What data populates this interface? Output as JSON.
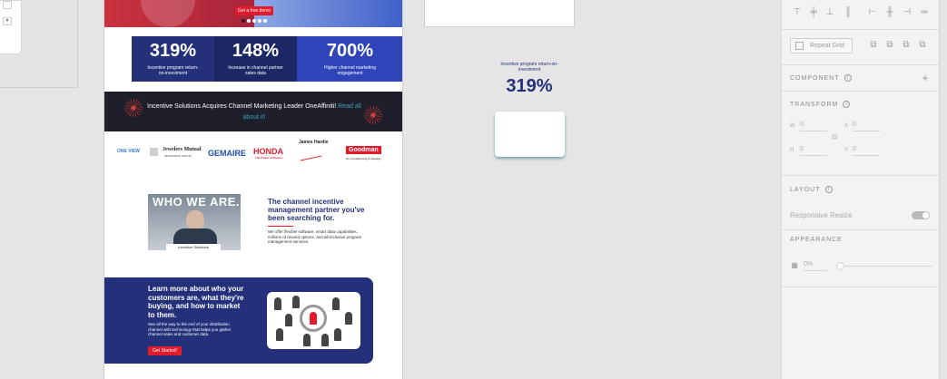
{
  "left_artboard": {
    "mini_arrow": "▾"
  },
  "artboard": {
    "hero": {
      "button_label": "Get a free demo"
    },
    "stats": [
      {
        "value": "319%",
        "label": "Incentive program return-on-investment"
      },
      {
        "value": "148%",
        "label": "Increase in channel partner sales data"
      },
      {
        "value": "700%",
        "label": "Higher channel marketing engagement"
      }
    ],
    "news": {
      "text": "Incentive Solutions Acquires Channel Marketing Leader OneAffiniti!",
      "link": "Read all about it!"
    },
    "logos": {
      "l1": "ONE VIEW",
      "l2": "Jewelers Mutual",
      "l2_sub": "INSURANCE GROUP",
      "l3": "GEMAIRE",
      "l4": "HONDA",
      "l4_sub": "The Power of Dreams",
      "l5": "James Hardie",
      "l6": "Goodman",
      "l6_sub": "Air Conditioning & Heating"
    },
    "who": {
      "image_title": "WHO WE ARE.",
      "banner": "Incentive Solutions",
      "heading": "The channel incentive management partner you've been searching for.",
      "body": "We offer flexible software, smart data capabilities, millions of reward options, and all-inclusive program management services."
    },
    "cta": {
      "title": "Learn more about who your customers are, what they're buying, and how to market to them.",
      "body": "See all the way to the end of your distribution channel with technology that helps you gather channel sales and customer data.",
      "button_label": "Get Started!"
    }
  },
  "floating": {
    "label": "Incentive program return-on-investment",
    "value": "319%"
  },
  "panel": {
    "repeat_grid_label": "Repeat Grid",
    "component_title": "COMPONENT",
    "component_add": "+",
    "transform_title": "TRANSFORM",
    "w_label": "W",
    "w_value": "0",
    "h_label": "H",
    "h_value": "0",
    "x_label": "X",
    "x_value": "0",
    "y_label": "Y",
    "y_value": "0",
    "layout_title": "LAYOUT",
    "responsive_label": "Responsive Resize",
    "appearance_title": "APPEARANCE",
    "opacity_value": "0%"
  },
  "colors": {
    "navy": "#24307a",
    "red": "#e11b2c",
    "panel_bg": "#f3f3f3",
    "canvas_bg": "#e5e5e5"
  }
}
